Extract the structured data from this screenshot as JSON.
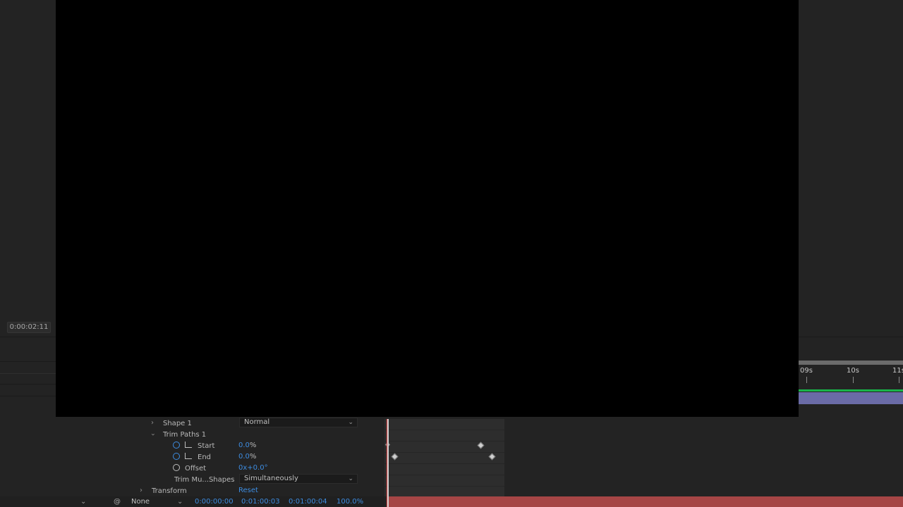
{
  "viewer": {
    "current_time": "0:00:02:11"
  },
  "ruler": {
    "ticks": [
      "09s",
      "10s",
      "11s"
    ]
  },
  "layers": {
    "shape1": {
      "label": "Shape 1",
      "blend_mode": "Normal"
    },
    "trim_paths": {
      "label": "Trim Paths 1",
      "start": {
        "label": "Start",
        "value": "0.0",
        "unit": "%"
      },
      "end": {
        "label": "End",
        "value": "0.0",
        "unit": "%"
      },
      "offset": {
        "label": "Offset",
        "value": "0x+0.0°"
      },
      "trim_multiple": {
        "label": "Trim Mu...Shapes",
        "value": "Simultaneously"
      }
    },
    "transform": {
      "label": "Transform",
      "reset": "Reset"
    }
  },
  "bottom_bar": {
    "parent": "None",
    "time_in": "0:00:00:00",
    "time_out": "0:01:00:03",
    "duration": "0:01:00:04",
    "stretch": "100.0%"
  }
}
